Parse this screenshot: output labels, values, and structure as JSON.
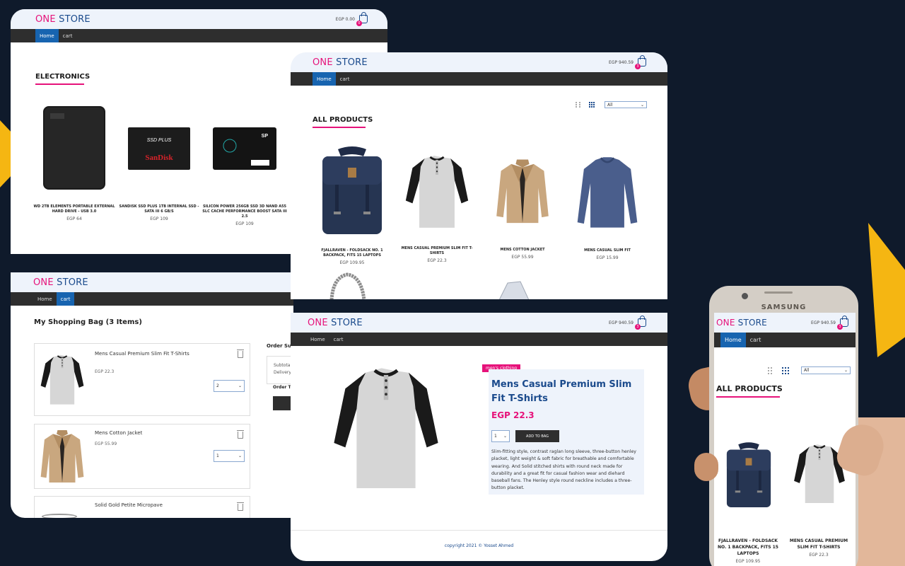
{
  "brand": {
    "one": "ONE",
    "store": "STORE"
  },
  "nav": {
    "home": "Home",
    "cart": "cart"
  },
  "colors": {
    "background": "#0f1a2b",
    "accent_yellow": "#f5b612",
    "pink": "#e6127a",
    "blue": "#1a4a8c",
    "nav_dark": "#2e2e2e",
    "nav_active": "#1764b0"
  },
  "balances": {
    "empty": "EGP 0.00",
    "full": "EGP 940.59"
  },
  "bag_counts": {
    "zero": "0",
    "three": "3"
  },
  "electronics": {
    "title": "ELECTRONICS",
    "items": [
      {
        "name": "WD 2TB ELEMENTS PORTABLE EXTERNAL HARD DRIVE - USB 3.0",
        "price": "EGP 64"
      },
      {
        "name": "SANDISK SSD PLUS 1TB INTERNAL SSD - SATA III 6 GB/S",
        "price": "EGP 109",
        "brand": "SanDisk",
        "model": "SSD PLUS"
      },
      {
        "name": "SILICON POWER 256GB SSD 3D NAND A55 SLC CACHE PERFORMANCE BOOST SATA III 2.5",
        "price": "EGP 109",
        "brand": "SP"
      }
    ]
  },
  "all_products": {
    "title": "ALL PRODUCTS",
    "filter": "All",
    "items": [
      {
        "name": "FJALLRAVEN - FOLDSACK NO. 1 BACKPACK, FITS 15 LAPTOPS",
        "price": "EGP 109.95"
      },
      {
        "name": "MENS CASUAL PREMIUM SLIM FIT T-SHIRTS",
        "price": "EGP 22.3"
      },
      {
        "name": "MENS COTTON JACKET",
        "price": "EGP 55.99"
      },
      {
        "name": "MENS CASUAL SLIM FIT",
        "price": "EGP 15.99"
      }
    ]
  },
  "cart": {
    "title": "My Shopping Bag (3 Items)",
    "items": [
      {
        "name": "Mens Casual Premium Slim Fit T-Shirts",
        "price": "EGP 22.3",
        "qty": "2"
      },
      {
        "name": "Mens Cotton Jacket",
        "price": "EGP 55.99",
        "qty": "1"
      },
      {
        "name": "Solid Gold Petite Micropave"
      }
    ],
    "summary": {
      "title": "Order Su",
      "subtotal": "Subtota",
      "delivery": "Delivery",
      "total": "Order T"
    }
  },
  "detail": {
    "category": "men's clothing",
    "title": "Mens Casual Premium Slim Fit T-Shirts",
    "price": "EGP 22.3",
    "qty": "1",
    "add_btn": "ADD TO BAG",
    "description": "Slim-fitting style, contrast raglan long sleeve, three-button henley placket, light weight & soft fabric for breathable and comfortable wearing. And Solid stitched shirts with round neck made for durability and a great fit for casual fashion wear and diehard baseball fans. The Henley style round neckline includes a three-button placket.",
    "footer": "copyright 2021 © Yosset Ahmed"
  },
  "phone": {
    "brand": "SAMSUNG",
    "items": [
      {
        "name": "FJALLRAVEN - FOLDSACK NO. 1 BACKPACK, FITS 15 LAPTOPS",
        "price": "EGP 109.95"
      },
      {
        "name": "MENS CASUAL PREMIUM SLIM FIT T-SHIRTS",
        "price": "EGP 22.3"
      }
    ]
  },
  "icons": [
    "shopping-bag-icon",
    "grid-small-icon",
    "grid-large-icon",
    "trash-icon",
    "chevron-down-icon"
  ]
}
